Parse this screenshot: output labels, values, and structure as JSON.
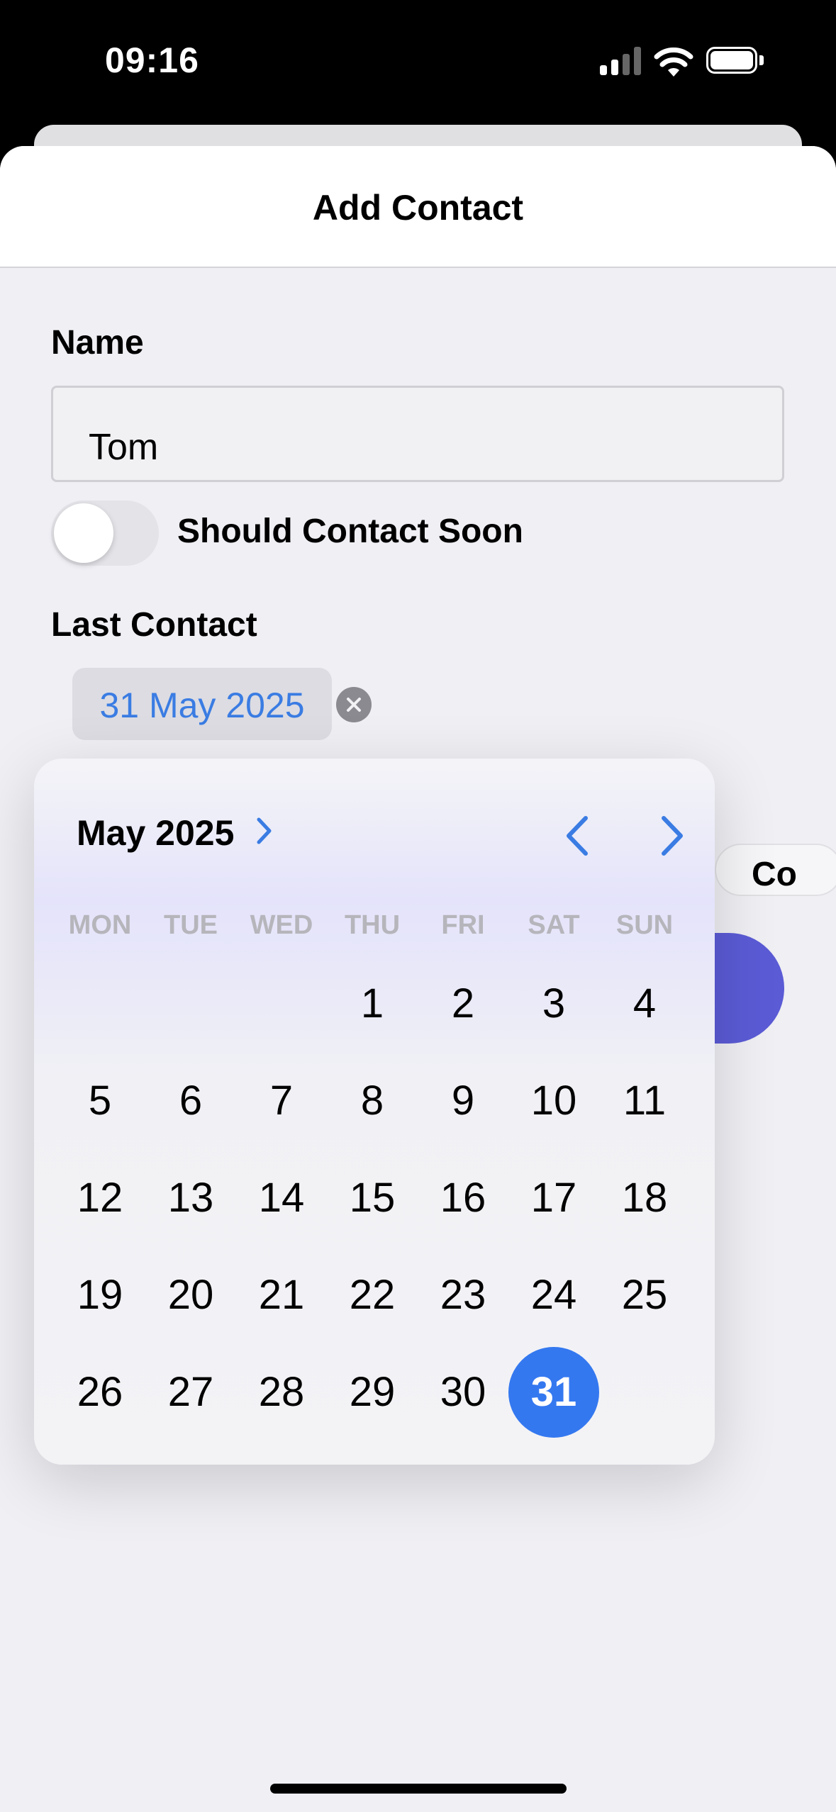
{
  "status_bar": {
    "time": "09:16"
  },
  "sheet": {
    "title": "Add Contact",
    "name_label": "Name",
    "name_value": "Tom",
    "toggle_label": "Should Contact Soon",
    "toggle_on": false,
    "last_contact_label": "Last Contact",
    "last_contact_value": "31 May 2025",
    "partial_button_text": "Co"
  },
  "calendar": {
    "month_label": "May 2025",
    "weekdays": [
      "MON",
      "TUE",
      "WED",
      "THU",
      "FRI",
      "SAT",
      "SUN"
    ],
    "first_weekday_index": 3,
    "days_in_month": 31,
    "selected_day": 31
  },
  "colors": {
    "accent": "#3478f0",
    "link": "#3a7ce3",
    "secondary_button": "#5b5bd6"
  }
}
